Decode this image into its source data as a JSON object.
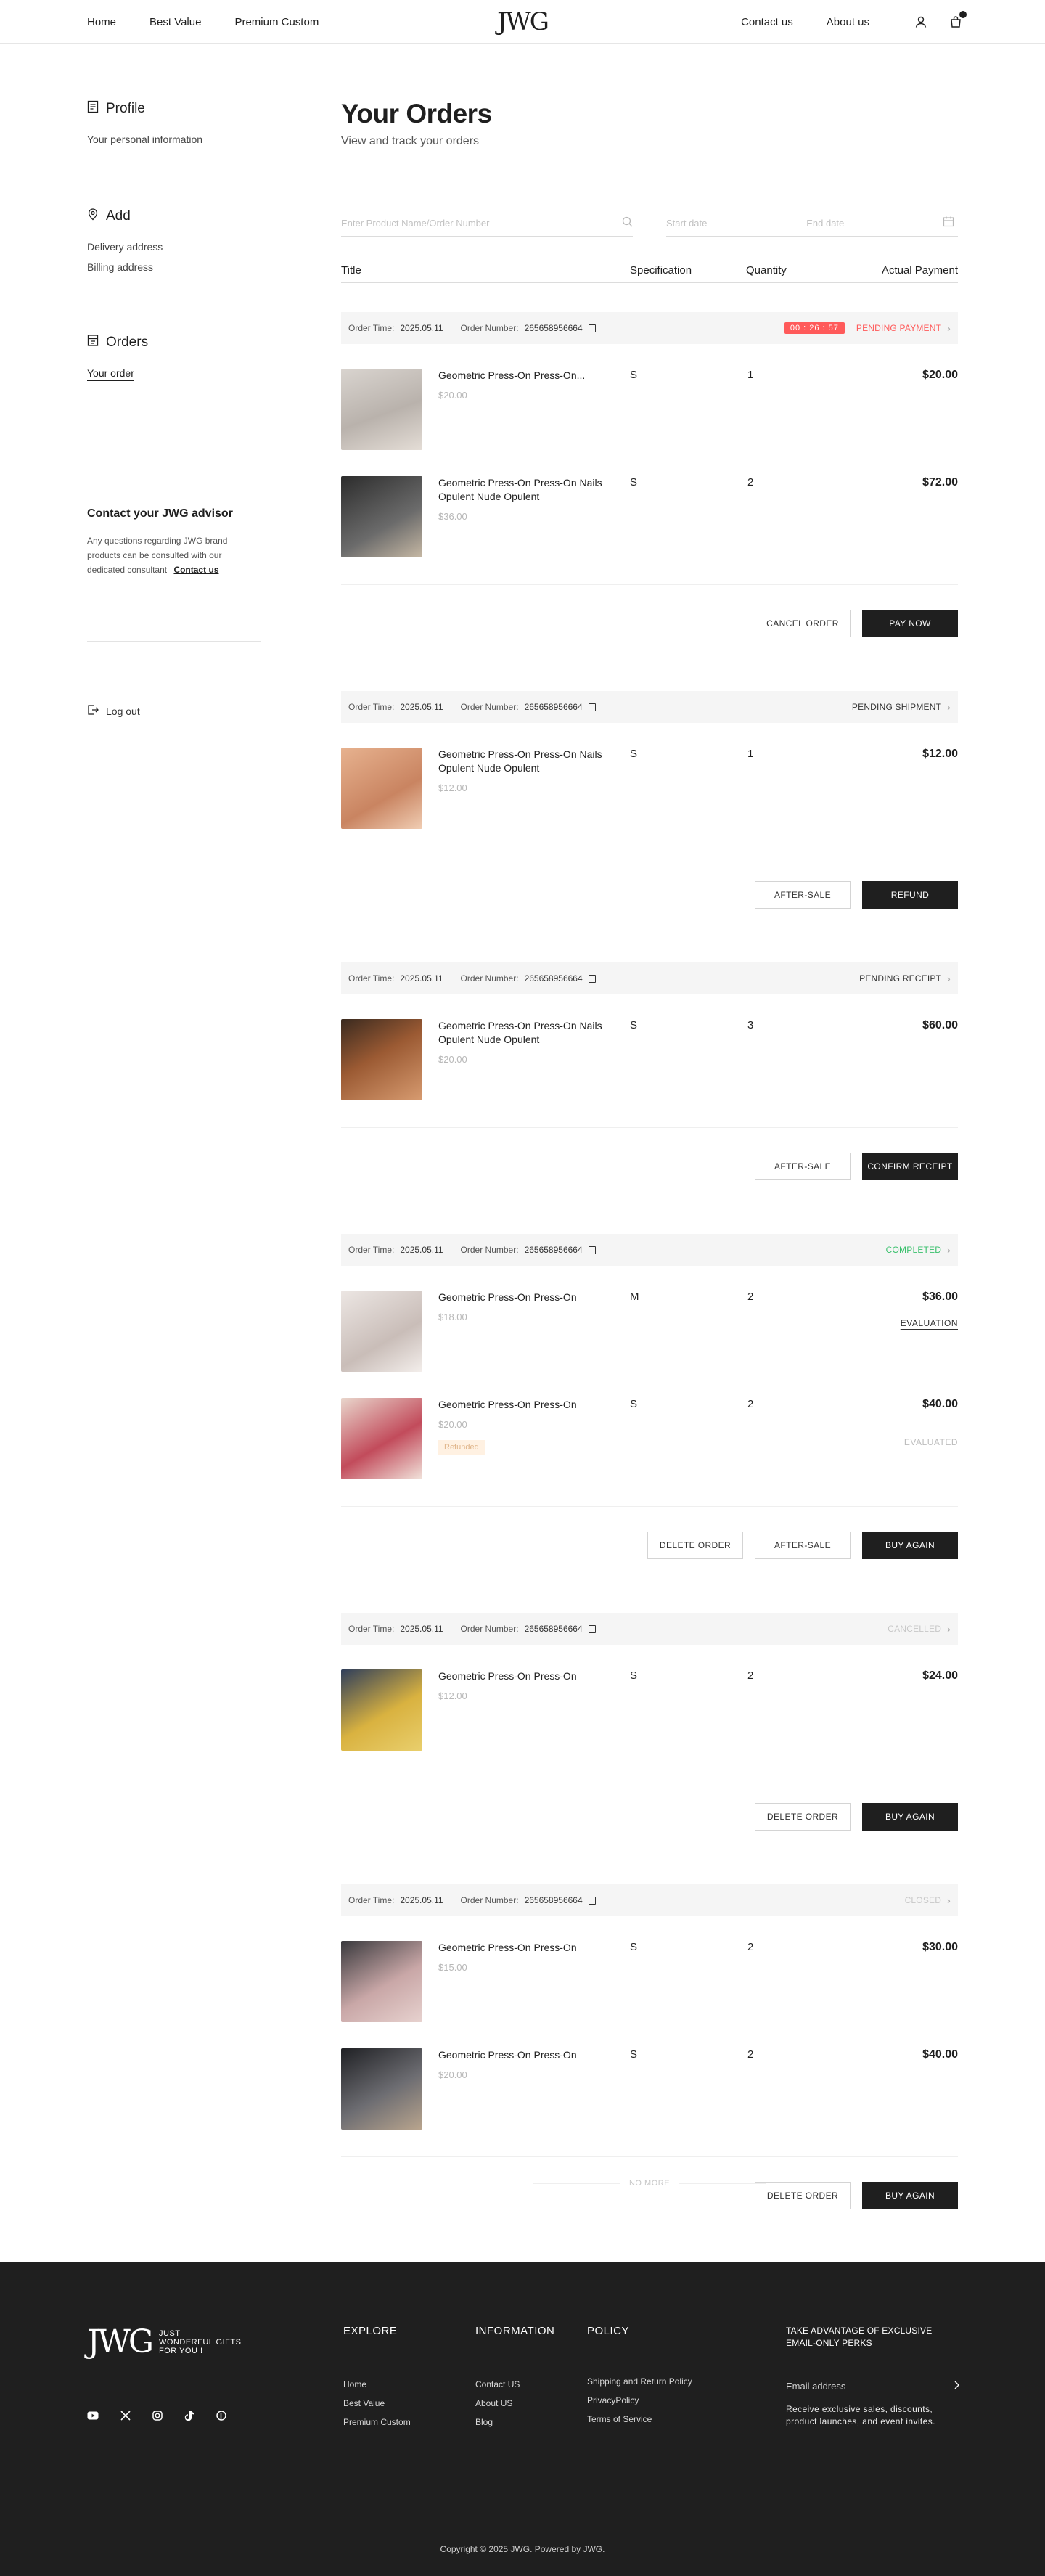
{
  "header": {
    "nav_left": [
      "Home",
      "Best Value",
      "Premium Custom"
    ],
    "logo": "JWG",
    "nav_right": [
      "Contact us",
      "About us"
    ]
  },
  "sidebar": {
    "profile_title": "Profile",
    "profile_sub": "Your personal information",
    "add_title": "Add",
    "delivery": "Delivery address",
    "billing": "Billing address",
    "orders_title": "Orders",
    "your_order": "Your order",
    "advisor_title": "Contact your JWG advisor",
    "advisor_text": "Any questions regarding JWG brand products can be consulted with our dedicated consultant",
    "advisor_link": "Contact us",
    "logout": "Log out"
  },
  "main": {
    "title": "Your Orders",
    "subtitle": "View and track your orders",
    "search_placeholder": "Enter Product Name/Order Number",
    "start_placeholder": "Start date",
    "end_placeholder": "End date",
    "columns": {
      "title": "Title",
      "spec": "Specification",
      "qty": "Quantity",
      "pay": "Actual Payment"
    }
  },
  "labels": {
    "order_time": "Order Time:",
    "order_number": "Order Number:"
  },
  "orders": [
    {
      "time": "2025.05.11",
      "number": "265658956664",
      "status": "PENDING PAYMENT",
      "status_color": "#ff5a5a",
      "timer": "00 : 26 : 57",
      "items": [
        {
          "name": "Geometric Press-On Press-On...",
          "price": "$20.00",
          "spec": "S",
          "qty": "1",
          "pay": "$20.00"
        },
        {
          "name": "Geometric Press-On Press-On Nails Opulent Nude Opulent",
          "price": "$36.00",
          "spec": "S",
          "qty": "2",
          "pay": "$72.00"
        }
      ],
      "actions": [
        "CANCEL ORDER",
        "PAY NOW"
      ]
    },
    {
      "time": "2025.05.11",
      "number": "265658956664",
      "status": "PENDING SHIPMENT",
      "status_color": "#333333",
      "items": [
        {
          "name": "Geometric Press-On Press-On Nails Opulent Nude Opulent",
          "price": "$12.00",
          "spec": "S",
          "qty": "1",
          "pay": "$12.00"
        }
      ],
      "actions": [
        "AFTER-SALE",
        "REFUND"
      ]
    },
    {
      "time": "2025.05.11",
      "number": "265658956664",
      "status": "PENDING RECEIPT",
      "status_color": "#333333",
      "items": [
        {
          "name": "Geometric Press-On Press-On Nails Opulent Nude Opulent",
          "price": "$20.00",
          "spec": "S",
          "qty": "3",
          "pay": "$60.00"
        }
      ],
      "actions": [
        "AFTER-SALE",
        "CONFIRM RECEIPT"
      ]
    },
    {
      "time": "2025.05.11",
      "number": "265658956664",
      "status": "COMPLETED",
      "status_color": "#39c06c",
      "items": [
        {
          "name": "Geometric Press-On Press-On",
          "price": "$18.00",
          "spec": "M",
          "qty": "2",
          "pay": "$36.00",
          "extra": "EVALUATION"
        },
        {
          "name": "Geometric Press-On Press-On",
          "price": "$20.00",
          "spec": "S",
          "qty": "2",
          "pay": "$40.00",
          "extra_done": "EVALUATED",
          "tag": "Refunded"
        }
      ],
      "actions": [
        "DELETE ORDER",
        "AFTER-SALE",
        "BUY AGAIN"
      ]
    },
    {
      "time": "2025.05.11",
      "number": "265658956664",
      "status": "CANCELLED",
      "status_color": "#c8c8c8",
      "items": [
        {
          "name": "Geometric Press-On Press-On",
          "price": "$12.00",
          "spec": "S",
          "qty": "2",
          "pay": "$24.00"
        }
      ],
      "actions": [
        "DELETE ORDER",
        "BUY AGAIN"
      ]
    },
    {
      "time": "2025.05.11",
      "number": "265658956664",
      "status": "CLOSED",
      "status_color": "#c8c8c8",
      "items": [
        {
          "name": "Geometric Press-On Press-On",
          "price": "$15.00",
          "spec": "S",
          "qty": "2",
          "pay": "$30.00"
        },
        {
          "name": "Geometric Press-On Press-On",
          "price": "$20.00",
          "spec": "S",
          "qty": "2",
          "pay": "$40.00"
        }
      ],
      "actions": [
        "DELETE ORDER",
        "BUY AGAIN"
      ]
    }
  ],
  "no_more": "NO MORE",
  "footer": {
    "logo_mark": "JWG",
    "tagline": [
      "JUST",
      "WONDERFUL GIFTS",
      "FOR YOU !"
    ],
    "explore_title": "EXPLORE",
    "explore_links": [
      "Home",
      "Best Value",
      "Premium Custom"
    ],
    "info_title": "INFORMATION",
    "info_links": [
      "Contact US",
      "About US",
      "Blog"
    ],
    "policy_title": "POLICY",
    "policy_links": [
      "Shipping and Return Policy",
      "PrivacyPolicy",
      "Terms of Service"
    ],
    "news_head": "TAKE ADVANTAGE OF EXCLUSIVE EMAIL-ONLY PERKS",
    "email_placeholder": "Email address",
    "news_desc": "Receive exclusive sales, discounts, product launches, and event invites.",
    "copyright": "Copyright © 2025 JWG. Powered by JWG."
  }
}
